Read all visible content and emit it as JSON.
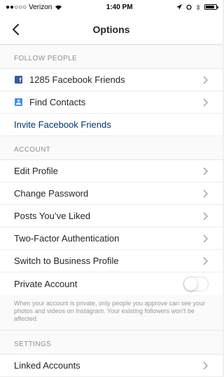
{
  "status_bar": {
    "carrier": "●●○○○ Verizon",
    "time": "1:40 PM"
  },
  "nav": {
    "title": "Options"
  },
  "sections": {
    "follow_people": {
      "header": "FOLLOW PEOPLE",
      "facebook_friends": "1285 Facebook Friends",
      "find_contacts": "Find Contacts",
      "invite": "Invite Facebook Friends"
    },
    "account": {
      "header": "ACCOUNT",
      "edit_profile": "Edit Profile",
      "change_password": "Change Password",
      "posts_liked": "Posts You’ve Liked",
      "two_factor": "Two-Factor Authentication",
      "business_profile": "Switch to Business Profile",
      "private_account": "Private Account",
      "private_account_on": false,
      "private_note": "When your account is private, only people you approve can see your photos and videos on Instagram. Your existing followers won't be affected."
    },
    "settings": {
      "header": "SETTINGS",
      "linked_accounts": "Linked Accounts"
    }
  },
  "colors": {
    "link_blue": "#003569",
    "facebook_blue": "#3b5998"
  }
}
